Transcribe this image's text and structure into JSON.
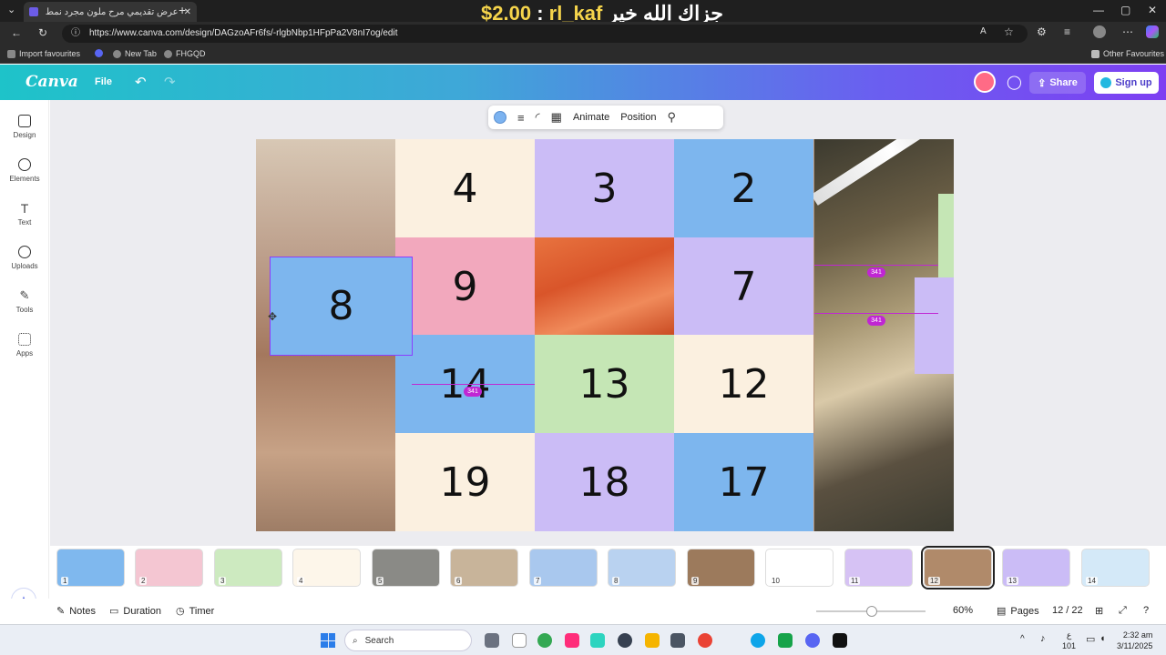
{
  "browser": {
    "tab_title": "عرض تقديمي مرح ملون مجرد نمط",
    "overlay_price": "$2.00",
    "overlay_sep": ":",
    "overlay_user": "rl_kaf",
    "overlay_arabic": "جزاك الله خير",
    "url": "https://www.canva.com/design/DAGzoAFr6fs/-rlgbNbp1HFpPa2V8nI7og/edit",
    "bookmarks": [
      "Import favourites",
      "New Tab",
      "FHGQD"
    ],
    "other_favourites": "Other Favourites"
  },
  "header": {
    "logo": "Canva",
    "file_label": "File",
    "share_label": "Share",
    "signup_label": "Sign up"
  },
  "sidebar": {
    "items": [
      {
        "label": "Design",
        "icon": "design-icon"
      },
      {
        "label": "Elements",
        "icon": "elements-icon"
      },
      {
        "label": "Text",
        "icon": "text-icon"
      },
      {
        "label": "Uploads",
        "icon": "uploads-icon"
      },
      {
        "label": "Tools",
        "icon": "tools-icon"
      },
      {
        "label": "Apps",
        "icon": "apps-icon"
      }
    ]
  },
  "toolbar": {
    "color": "#7cb3f0",
    "animate_label": "Animate",
    "position_label": "Position"
  },
  "slide": {
    "cells": [
      {
        "value": "4",
        "color": "#fbf0e0"
      },
      {
        "value": "3",
        "color": "#cbbcf6"
      },
      {
        "value": "2",
        "color": "#7db6ee"
      },
      {
        "value": "9",
        "color": "#f2a8bd"
      },
      {
        "value": "",
        "color": "salmon"
      },
      {
        "value": "7",
        "color": "#cbbcf6"
      },
      {
        "value": "14",
        "color": "#7db6ee"
      },
      {
        "value": "13",
        "color": "#c5e6b5"
      },
      {
        "value": "12",
        "color": "#fbf0e0"
      },
      {
        "value": "19",
        "color": "#fbf0e0"
      },
      {
        "value": "18",
        "color": "#cbbcf6"
      },
      {
        "value": "17",
        "color": "#7db6ee"
      }
    ],
    "selected_value": "8",
    "guide_badge": "341"
  },
  "thumbnails": [
    {
      "num": "1",
      "color": "#7fb8ee"
    },
    {
      "num": "2",
      "color": "#f4c6d2"
    },
    {
      "num": "3",
      "color": "#cdeac0"
    },
    {
      "num": "4",
      "color": "#fdf6ea"
    },
    {
      "num": "5",
      "color": "#8a8a86"
    },
    {
      "num": "6",
      "color": "#c8b49a"
    },
    {
      "num": "7",
      "color": "#a9c8ee"
    },
    {
      "num": "8",
      "color": "#b9d2f0"
    },
    {
      "num": "9",
      "color": "#9c7a5c"
    },
    {
      "num": "10",
      "color": "#ffffff"
    },
    {
      "num": "11",
      "color": "#d6c2f4"
    },
    {
      "num": "12",
      "color": "#b08a6a"
    },
    {
      "num": "13",
      "color": "#cbbcf6"
    },
    {
      "num": "14",
      "color": "#d4e9f8"
    }
  ],
  "bottombar": {
    "notes": "Notes",
    "duration": "Duration",
    "timer": "Timer",
    "zoom": "60%",
    "pages": "Pages",
    "page_count": "12 / 22"
  },
  "taskbar": {
    "search": "Search",
    "time": "2:32 am",
    "date": "3/11/2025",
    "lang_top": "ع",
    "lang_bottom": "101"
  }
}
